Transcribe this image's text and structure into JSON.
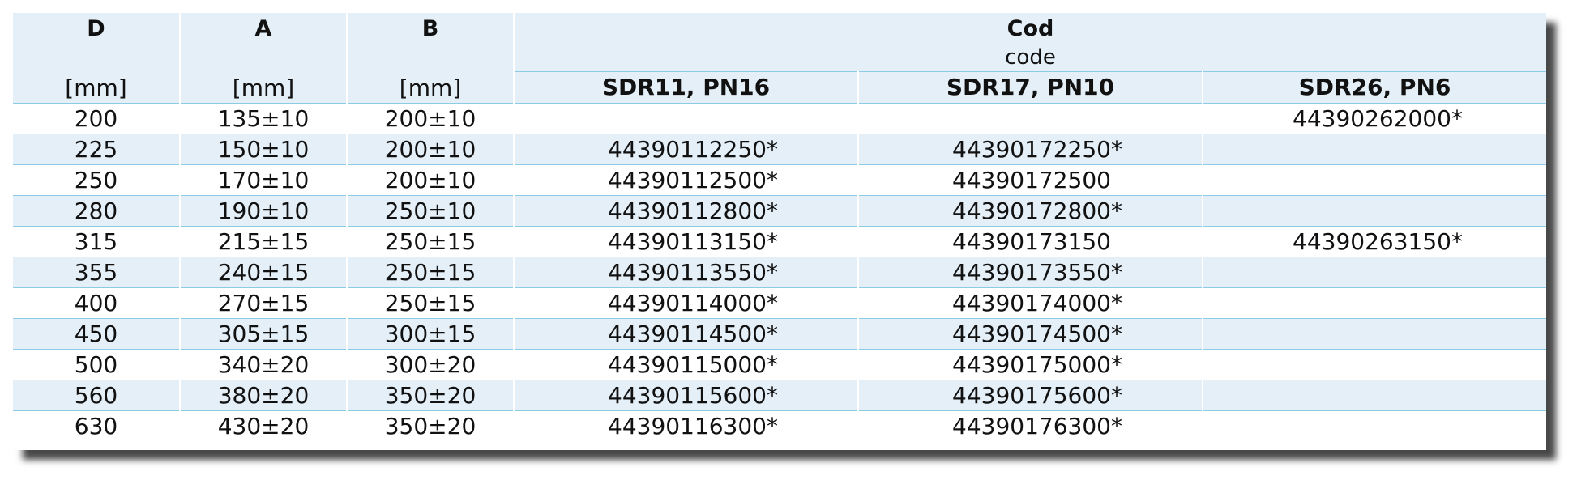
{
  "header": {
    "d": "D",
    "a": "A",
    "b": "B",
    "cod": "Cod",
    "code": "code",
    "unit_d": "[mm]",
    "unit_a": "[mm]",
    "unit_b": "[mm]",
    "sdr11": "SDR11, PN16",
    "sdr17": "SDR17, PN10",
    "sdr26": "SDR26, PN6"
  },
  "rows": [
    {
      "d": "200",
      "a": "135±10",
      "b": "200±10",
      "sdr11": "",
      "sdr17": "",
      "sdr26": "44390262000*"
    },
    {
      "d": "225",
      "a": "150±10",
      "b": "200±10",
      "sdr11": "44390112250*",
      "sdr17": "44390172250*",
      "sdr26": ""
    },
    {
      "d": "250",
      "a": "170±10",
      "b": "200±10",
      "sdr11": "44390112500*",
      "sdr17": "44390172500",
      "sdr26": ""
    },
    {
      "d": "280",
      "a": "190±10",
      "b": "250±10",
      "sdr11": "44390112800*",
      "sdr17": "44390172800*",
      "sdr26": ""
    },
    {
      "d": "315",
      "a": "215±15",
      "b": "250±15",
      "sdr11": "44390113150*",
      "sdr17": "44390173150",
      "sdr26": "44390263150*"
    },
    {
      "d": "355",
      "a": "240±15",
      "b": "250±15",
      "sdr11": "44390113550*",
      "sdr17": "44390173550*",
      "sdr26": ""
    },
    {
      "d": "400",
      "a": "270±15",
      "b": "250±15",
      "sdr11": "44390114000*",
      "sdr17": "44390174000*",
      "sdr26": ""
    },
    {
      "d": "450",
      "a": "305±15",
      "b": "300±15",
      "sdr11": "44390114500*",
      "sdr17": "44390174500*",
      "sdr26": ""
    },
    {
      "d": "500",
      "a": "340±20",
      "b": "300±20",
      "sdr11": "44390115000*",
      "sdr17": "44390175000*",
      "sdr26": ""
    },
    {
      "d": "560",
      "a": "380±20",
      "b": "350±20",
      "sdr11": "44390115600*",
      "sdr17": "44390175600*",
      "sdr26": ""
    },
    {
      "d": "630",
      "a": "430±20",
      "b": "350±20",
      "sdr11": "44390116300*",
      "sdr17": "44390176300*",
      "sdr26": ""
    }
  ]
}
